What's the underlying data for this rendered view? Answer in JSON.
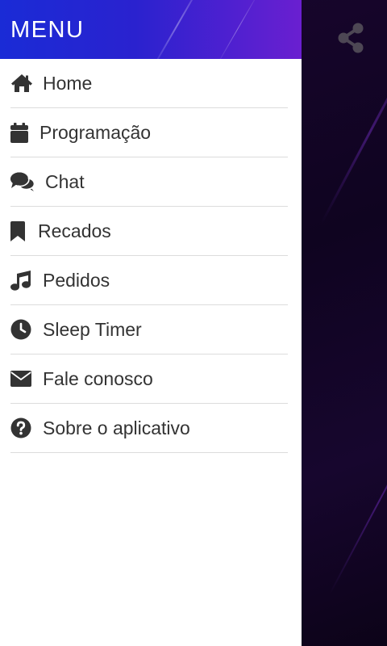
{
  "drawer": {
    "title": "MENU",
    "items": [
      {
        "label": "Home",
        "icon": "home-icon"
      },
      {
        "label": "Programação",
        "icon": "calendar-icon"
      },
      {
        "label": "Chat",
        "icon": "chat-icon"
      },
      {
        "label": "Recados",
        "icon": "bookmark-icon"
      },
      {
        "label": "Pedidos",
        "icon": "music-note-icon"
      },
      {
        "label": "Sleep Timer",
        "icon": "clock-icon"
      },
      {
        "label": "Fale conosco",
        "icon": "envelope-icon"
      },
      {
        "label": "Sobre o aplicativo",
        "icon": "help-circle-icon"
      }
    ]
  },
  "topbar": {
    "share_icon": "share-icon"
  },
  "colors": {
    "header_gradient_start": "#1a2bd6",
    "header_gradient_end": "#6a1fd0",
    "text": "#333333",
    "divider": "#dcdcdc",
    "background": "#14052a"
  }
}
